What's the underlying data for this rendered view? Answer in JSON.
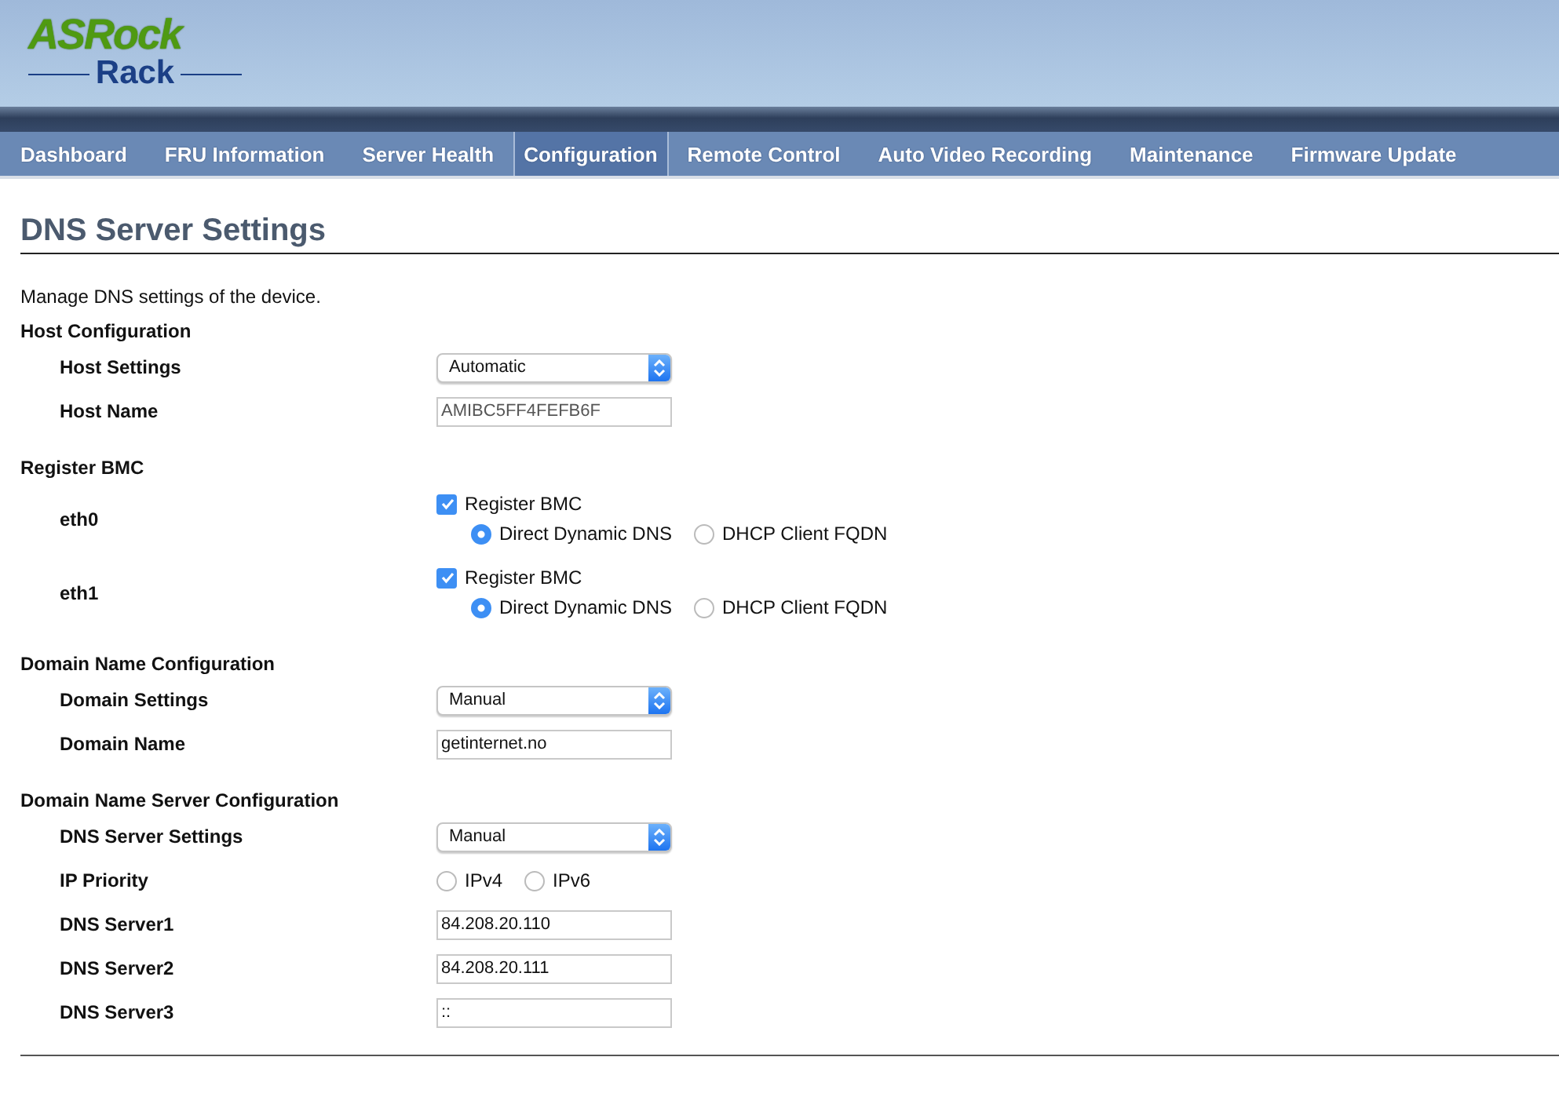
{
  "logo": {
    "brand": "ASRock",
    "sub": "Rack"
  },
  "nav": [
    {
      "label": "Dashboard",
      "selected": false
    },
    {
      "label": "FRU Information",
      "selected": false
    },
    {
      "label": "Server Health",
      "selected": false
    },
    {
      "label": "Configuration",
      "selected": true
    },
    {
      "label": "Remote Control",
      "selected": false
    },
    {
      "label": "Auto Video Recording",
      "selected": false
    },
    {
      "label": "Maintenance",
      "selected": false
    },
    {
      "label": "Firmware Update",
      "selected": false
    }
  ],
  "page_title": "DNS Server Settings",
  "description": "Manage DNS settings of the device.",
  "sections": [
    {
      "title": "Host Configuration",
      "rows": [
        {
          "kind": "select",
          "label": "Host Settings",
          "value": "Automatic"
        },
        {
          "kind": "text",
          "label": "Host Name",
          "value": "AMIBC5FF4FEFB6F",
          "disabled": true
        }
      ]
    },
    {
      "title": "Register BMC",
      "rows": [
        {
          "kind": "register",
          "label": "eth0",
          "checkbox": {
            "label": "Register BMC",
            "checked": true
          },
          "options": [
            {
              "label": "Direct Dynamic DNS",
              "selected": true
            },
            {
              "label": "DHCP Client FQDN",
              "selected": false
            }
          ]
        },
        {
          "kind": "register",
          "label": "eth1",
          "checkbox": {
            "label": "Register BMC",
            "checked": true
          },
          "options": [
            {
              "label": "Direct Dynamic DNS",
              "selected": true
            },
            {
              "label": "DHCP Client FQDN",
              "selected": false
            }
          ]
        }
      ]
    },
    {
      "title": "Domain Name Configuration",
      "rows": [
        {
          "kind": "select",
          "label": "Domain Settings",
          "value": "Manual"
        },
        {
          "kind": "text",
          "label": "Domain Name",
          "value": "getinternet.no",
          "disabled": false
        }
      ]
    },
    {
      "title": "Domain Name Server Configuration",
      "rows": [
        {
          "kind": "select",
          "label": "DNS Server Settings",
          "value": "Manual"
        },
        {
          "kind": "radios",
          "label": "IP Priority",
          "options": [
            {
              "label": "IPv4",
              "selected": false
            },
            {
              "label": "IPv6",
              "selected": false
            }
          ]
        },
        {
          "kind": "text",
          "label": "DNS Server1",
          "value": "84.208.20.110",
          "disabled": false
        },
        {
          "kind": "text",
          "label": "DNS Server2",
          "value": "84.208.20.111",
          "disabled": false
        },
        {
          "kind": "text",
          "label": "DNS Server3",
          "value": "::",
          "disabled": false
        }
      ]
    }
  ]
}
